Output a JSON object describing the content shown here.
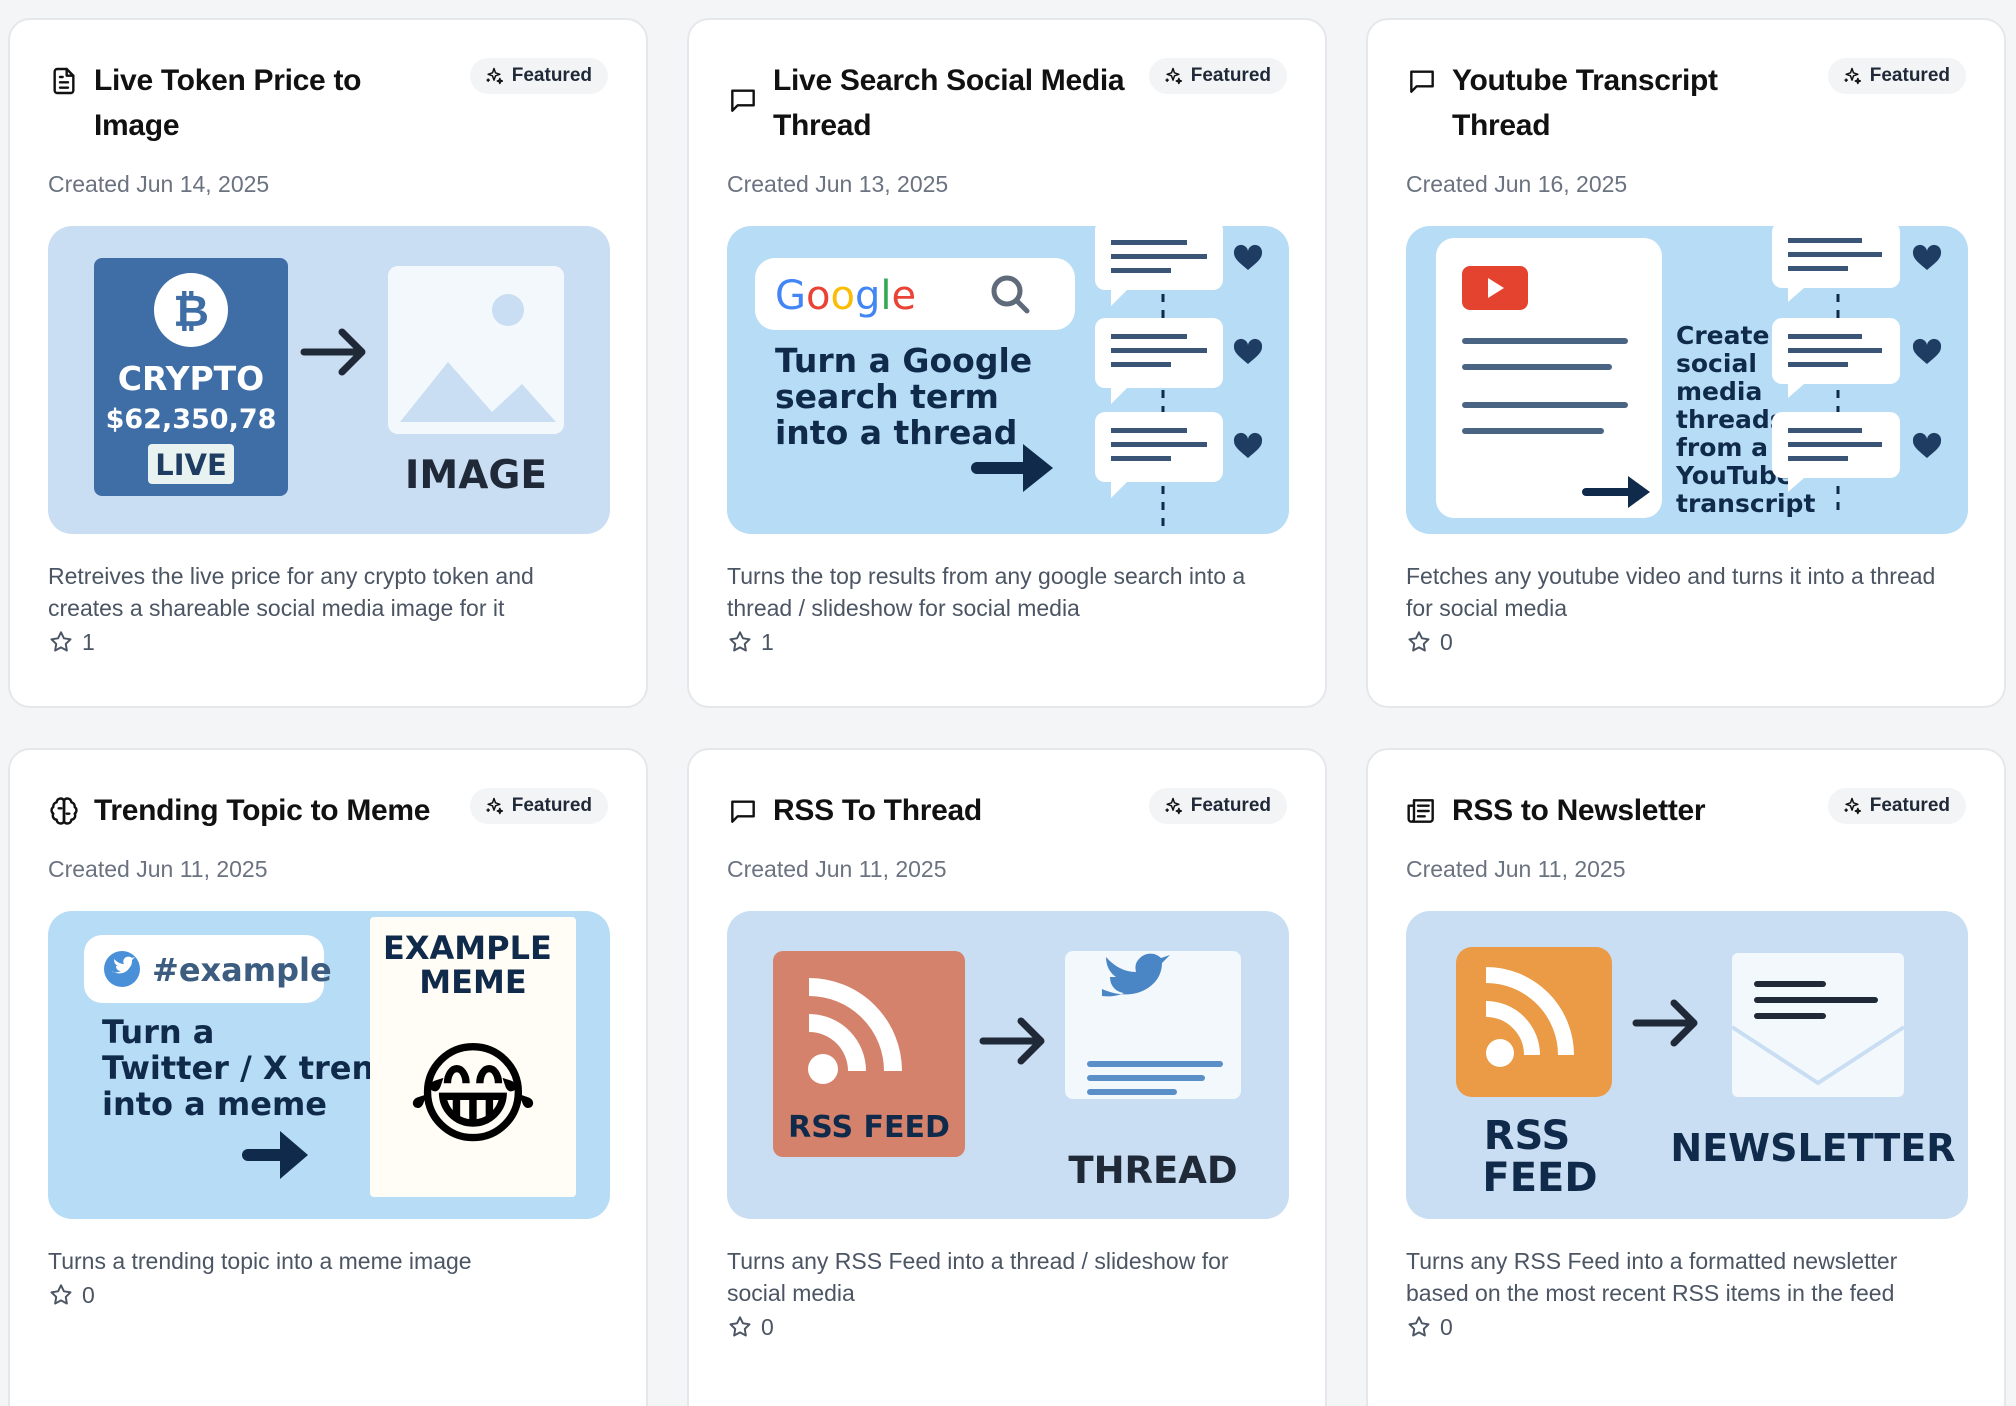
{
  "badge_label": "Featured",
  "cards": [
    {
      "title": "Live Token Price to Image",
      "icon": "document-icon",
      "created": "Created Jun 14, 2025",
      "description": "Retreives the live price for any crypto token and creates a shareable social media image for it",
      "stars": "1",
      "thumb": {
        "coin_symbol": "₿",
        "line1": "CRYPTO",
        "price": "$62,350,78",
        "tag": "LIVE",
        "target": "IMAGE"
      }
    },
    {
      "title": "Live Search Social Media Thread",
      "icon": "message-square-icon",
      "created": "Created Jun 13, 2025",
      "description": "Turns the top results from any google search into a thread / slideshow for social media",
      "stars": "1",
      "thumb": {
        "logo": "Google",
        "caption": [
          "Turn a Google",
          "search term",
          "into a thread"
        ]
      }
    },
    {
      "title": "Youtube Transcript Thread",
      "icon": "message-square-icon",
      "created": "Created Jun 16, 2025",
      "description": "Fetches any youtube video and turns it into a thread for social media",
      "stars": "0",
      "thumb": {
        "caption": [
          "Create",
          "social",
          "media",
          "threads",
          "from a",
          "YouTube",
          "transcript"
        ]
      }
    },
    {
      "title": "Trending Topic to Meme",
      "icon": "brain-icon",
      "created": "Created Jun 11, 2025",
      "description": "Turns a trending topic into a meme image",
      "stars": "0",
      "thumb": {
        "hashtag": "#example",
        "caption": [
          "Turn a",
          "Twitter / X trend",
          "into a meme"
        ],
        "meme": [
          "EXAMPLE",
          "MEME"
        ],
        "emoji": "😂"
      }
    },
    {
      "title": "RSS To Thread",
      "icon": "message-square-icon",
      "created": "Created Jun 11, 2025",
      "description": "Turns any RSS Feed into a thread / slideshow for social media",
      "stars": "0",
      "thumb": {
        "source": "RSS FEED",
        "target": "THREAD"
      }
    },
    {
      "title": "RSS to Newsletter",
      "icon": "newspaper-icon",
      "created": "Created Jun 11, 2025",
      "description": "Turns any RSS Feed into a formatted newsletter based on the most recent RSS items in the feed",
      "stars": "0",
      "thumb": {
        "source": [
          "RSS",
          "FEED"
        ],
        "target": "NEWSLETTER"
      }
    }
  ],
  "colors": {
    "thumb_bg_light": "#c9def2",
    "thumb_bg_blue": "#b7dcf5",
    "navy": "#0f2a4a",
    "crypto_blue": "#3f6ea7",
    "rss_red": "#d4826b",
    "rss_orange": "#eb9a45",
    "youtube_red": "#e4442f",
    "twitter_blue": "#5b8fc7"
  }
}
